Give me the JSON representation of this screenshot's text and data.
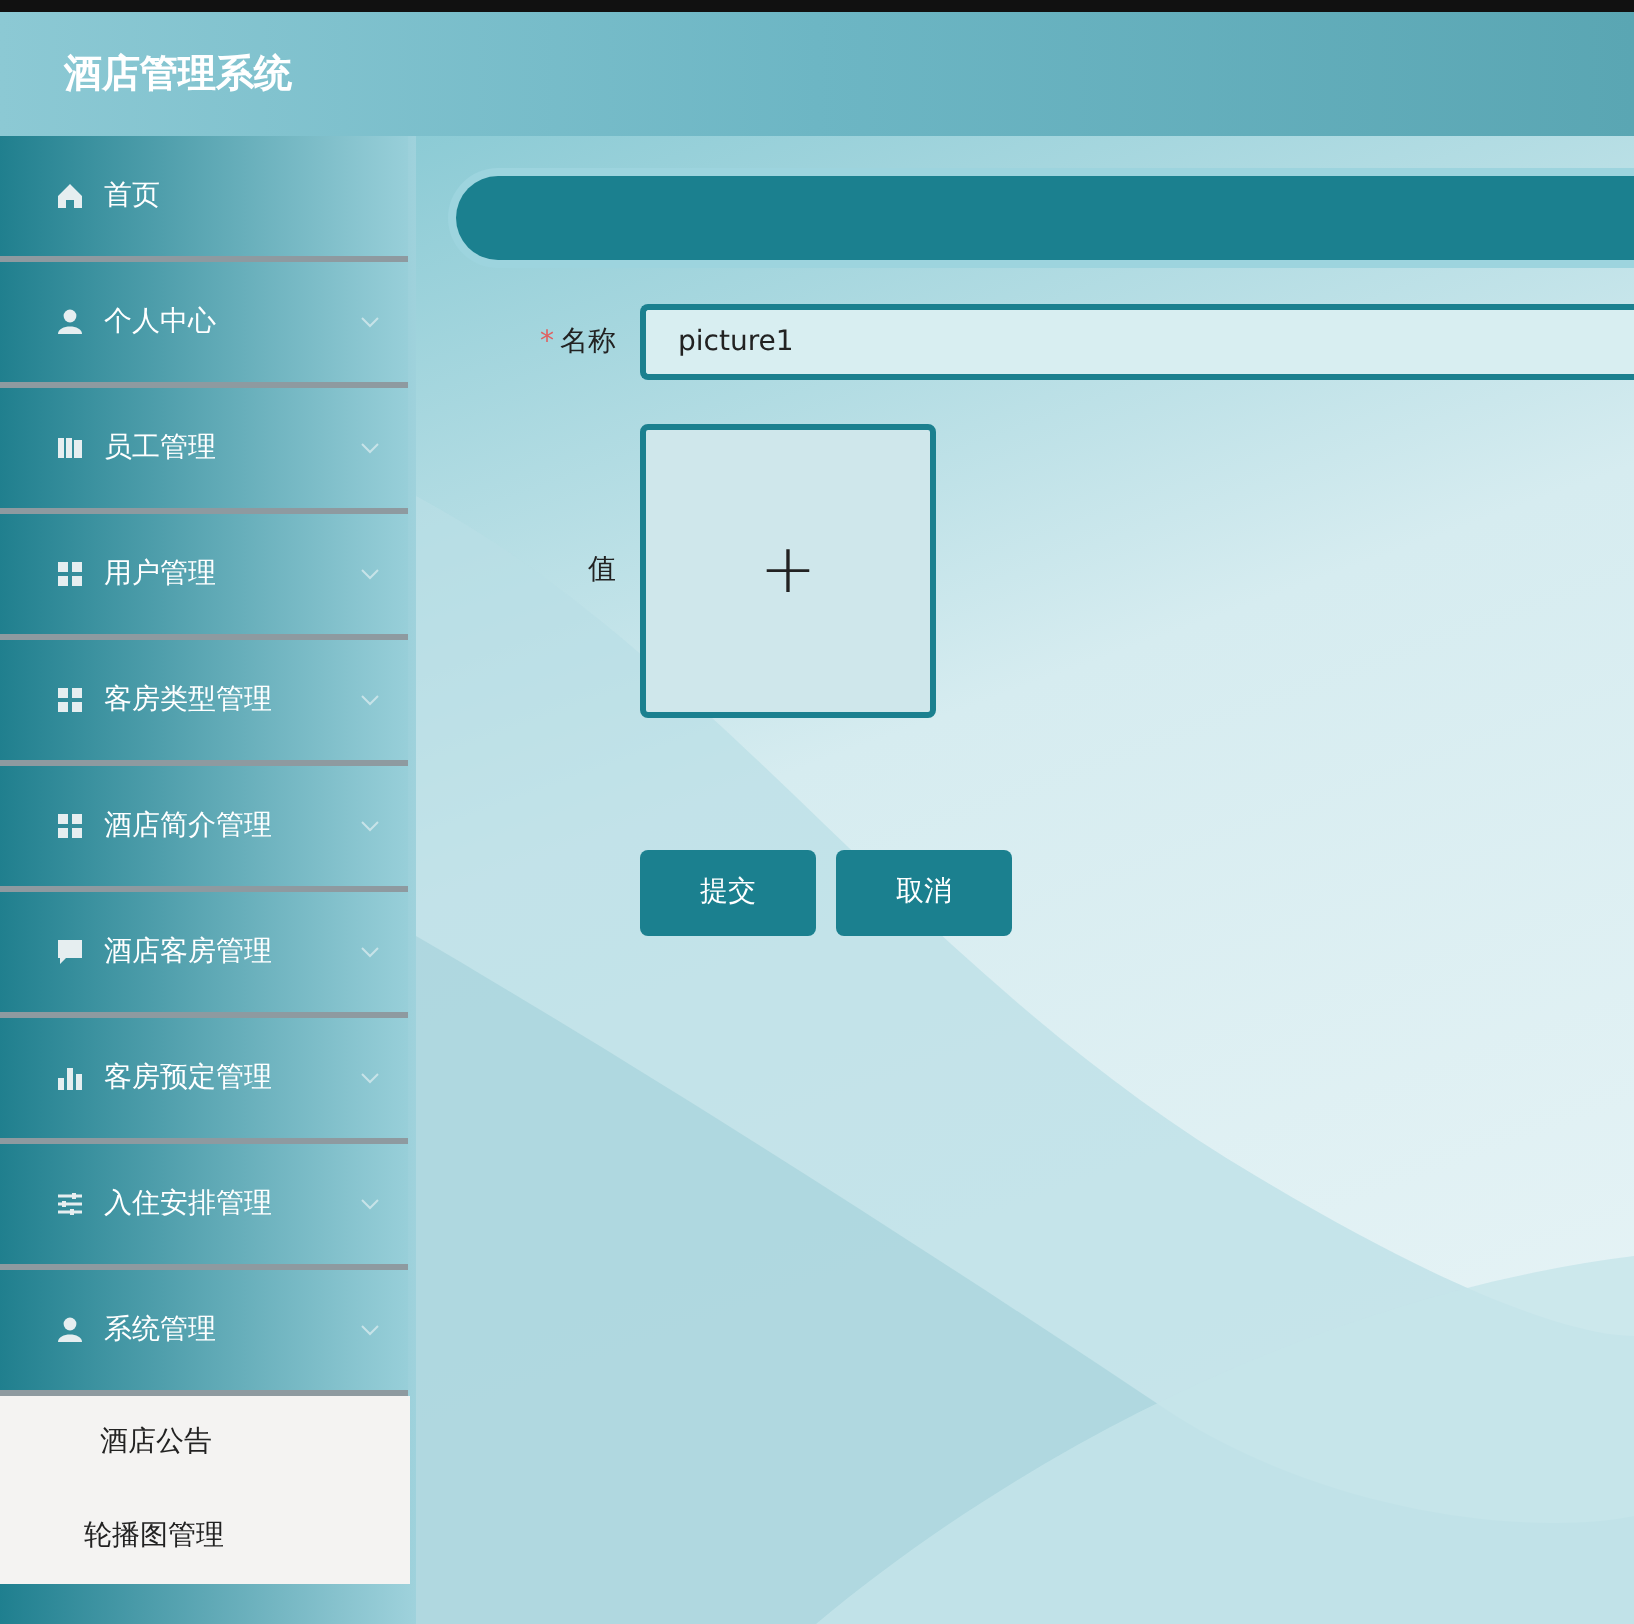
{
  "header": {
    "title": "酒店管理系统"
  },
  "sidebar": {
    "items": [
      {
        "label": "首页",
        "kind": "home",
        "submenu": false
      },
      {
        "label": "个人中心",
        "kind": "person",
        "submenu": true
      },
      {
        "label": "员工管理",
        "kind": "books",
        "submenu": true
      },
      {
        "label": "用户管理",
        "kind": "grid",
        "submenu": true
      },
      {
        "label": "客房类型管理",
        "kind": "grid",
        "submenu": true
      },
      {
        "label": "酒店简介管理",
        "kind": "grid",
        "submenu": true
      },
      {
        "label": "酒店客房管理",
        "kind": "chat",
        "submenu": true
      },
      {
        "label": "客房预定管理",
        "kind": "bars",
        "submenu": true
      },
      {
        "label": "入住安排管理",
        "kind": "sliders",
        "submenu": true
      },
      {
        "label": "系统管理",
        "kind": "person",
        "submenu": true,
        "children": [
          {
            "label": "酒店公告"
          },
          {
            "label": "轮播图管理"
          }
        ]
      }
    ]
  },
  "form": {
    "fields": [
      {
        "label": "名称",
        "required_mark": "*",
        "kind": "text",
        "value": "picture1"
      },
      {
        "label": "值",
        "kind": "upload",
        "value": "+"
      }
    ],
    "buttons": [
      "提交",
      "取消"
    ]
  }
}
